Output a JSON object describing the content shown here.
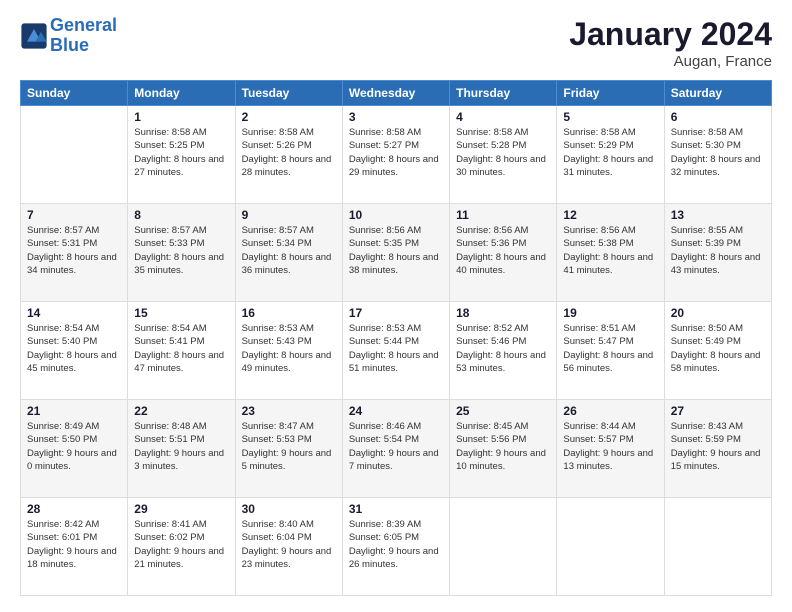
{
  "header": {
    "logo_line1": "General",
    "logo_line2": "Blue",
    "title": "January 2024",
    "subtitle": "Augan, France"
  },
  "days_of_week": [
    "Sunday",
    "Monday",
    "Tuesday",
    "Wednesday",
    "Thursday",
    "Friday",
    "Saturday"
  ],
  "weeks": [
    [
      {
        "day": "",
        "sunrise": "",
        "sunset": "",
        "daylight": ""
      },
      {
        "day": "1",
        "sunrise": "8:58 AM",
        "sunset": "5:25 PM",
        "daylight": "8 hours and 27 minutes."
      },
      {
        "day": "2",
        "sunrise": "8:58 AM",
        "sunset": "5:26 PM",
        "daylight": "8 hours and 28 minutes."
      },
      {
        "day": "3",
        "sunrise": "8:58 AM",
        "sunset": "5:27 PM",
        "daylight": "8 hours and 29 minutes."
      },
      {
        "day": "4",
        "sunrise": "8:58 AM",
        "sunset": "5:28 PM",
        "daylight": "8 hours and 30 minutes."
      },
      {
        "day": "5",
        "sunrise": "8:58 AM",
        "sunset": "5:29 PM",
        "daylight": "8 hours and 31 minutes."
      },
      {
        "day": "6",
        "sunrise": "8:58 AM",
        "sunset": "5:30 PM",
        "daylight": "8 hours and 32 minutes."
      }
    ],
    [
      {
        "day": "7",
        "sunrise": "8:57 AM",
        "sunset": "5:31 PM",
        "daylight": "8 hours and 34 minutes."
      },
      {
        "day": "8",
        "sunrise": "8:57 AM",
        "sunset": "5:33 PM",
        "daylight": "8 hours and 35 minutes."
      },
      {
        "day": "9",
        "sunrise": "8:57 AM",
        "sunset": "5:34 PM",
        "daylight": "8 hours and 36 minutes."
      },
      {
        "day": "10",
        "sunrise": "8:56 AM",
        "sunset": "5:35 PM",
        "daylight": "8 hours and 38 minutes."
      },
      {
        "day": "11",
        "sunrise": "8:56 AM",
        "sunset": "5:36 PM",
        "daylight": "8 hours and 40 minutes."
      },
      {
        "day": "12",
        "sunrise": "8:56 AM",
        "sunset": "5:38 PM",
        "daylight": "8 hours and 41 minutes."
      },
      {
        "day": "13",
        "sunrise": "8:55 AM",
        "sunset": "5:39 PM",
        "daylight": "8 hours and 43 minutes."
      }
    ],
    [
      {
        "day": "14",
        "sunrise": "8:54 AM",
        "sunset": "5:40 PM",
        "daylight": "8 hours and 45 minutes."
      },
      {
        "day": "15",
        "sunrise": "8:54 AM",
        "sunset": "5:41 PM",
        "daylight": "8 hours and 47 minutes."
      },
      {
        "day": "16",
        "sunrise": "8:53 AM",
        "sunset": "5:43 PM",
        "daylight": "8 hours and 49 minutes."
      },
      {
        "day": "17",
        "sunrise": "8:53 AM",
        "sunset": "5:44 PM",
        "daylight": "8 hours and 51 minutes."
      },
      {
        "day": "18",
        "sunrise": "8:52 AM",
        "sunset": "5:46 PM",
        "daylight": "8 hours and 53 minutes."
      },
      {
        "day": "19",
        "sunrise": "8:51 AM",
        "sunset": "5:47 PM",
        "daylight": "8 hours and 56 minutes."
      },
      {
        "day": "20",
        "sunrise": "8:50 AM",
        "sunset": "5:49 PM",
        "daylight": "8 hours and 58 minutes."
      }
    ],
    [
      {
        "day": "21",
        "sunrise": "8:49 AM",
        "sunset": "5:50 PM",
        "daylight": "9 hours and 0 minutes."
      },
      {
        "day": "22",
        "sunrise": "8:48 AM",
        "sunset": "5:51 PM",
        "daylight": "9 hours and 3 minutes."
      },
      {
        "day": "23",
        "sunrise": "8:47 AM",
        "sunset": "5:53 PM",
        "daylight": "9 hours and 5 minutes."
      },
      {
        "day": "24",
        "sunrise": "8:46 AM",
        "sunset": "5:54 PM",
        "daylight": "9 hours and 7 minutes."
      },
      {
        "day": "25",
        "sunrise": "8:45 AM",
        "sunset": "5:56 PM",
        "daylight": "9 hours and 10 minutes."
      },
      {
        "day": "26",
        "sunrise": "8:44 AM",
        "sunset": "5:57 PM",
        "daylight": "9 hours and 13 minutes."
      },
      {
        "day": "27",
        "sunrise": "8:43 AM",
        "sunset": "5:59 PM",
        "daylight": "9 hours and 15 minutes."
      }
    ],
    [
      {
        "day": "28",
        "sunrise": "8:42 AM",
        "sunset": "6:01 PM",
        "daylight": "9 hours and 18 minutes."
      },
      {
        "day": "29",
        "sunrise": "8:41 AM",
        "sunset": "6:02 PM",
        "daylight": "9 hours and 21 minutes."
      },
      {
        "day": "30",
        "sunrise": "8:40 AM",
        "sunset": "6:04 PM",
        "daylight": "9 hours and 23 minutes."
      },
      {
        "day": "31",
        "sunrise": "8:39 AM",
        "sunset": "6:05 PM",
        "daylight": "9 hours and 26 minutes."
      },
      {
        "day": "",
        "sunrise": "",
        "sunset": "",
        "daylight": ""
      },
      {
        "day": "",
        "sunrise": "",
        "sunset": "",
        "daylight": ""
      },
      {
        "day": "",
        "sunrise": "",
        "sunset": "",
        "daylight": ""
      }
    ]
  ]
}
